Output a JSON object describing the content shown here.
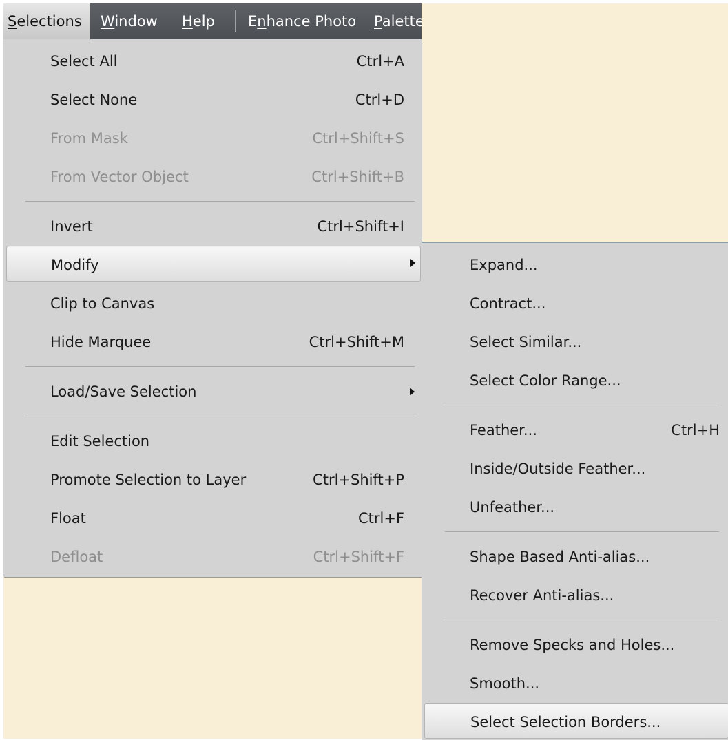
{
  "menubar": {
    "items": [
      {
        "label": "Selections",
        "mnemonic_index": 0
      },
      {
        "label": "Window",
        "mnemonic_index": 0
      },
      {
        "label": "Help",
        "mnemonic_index": 0
      },
      {
        "label": "Enhance Photo",
        "mnemonic_index": 1
      },
      {
        "label": "Palettes",
        "mnemonic_index": 0
      }
    ]
  },
  "selections_menu": {
    "items": [
      {
        "label": "Select All",
        "shortcut": "Ctrl+A",
        "disabled": false
      },
      {
        "label": "Select None",
        "shortcut": "Ctrl+D",
        "disabled": false
      },
      {
        "label": "From Mask",
        "shortcut": "Ctrl+Shift+S",
        "disabled": true
      },
      {
        "label": "From Vector Object",
        "shortcut": "Ctrl+Shift+B",
        "disabled": true
      },
      {
        "label": "Invert",
        "shortcut": "Ctrl+Shift+I",
        "disabled": false
      },
      {
        "label": "Modify",
        "shortcut": "",
        "disabled": false,
        "submenu": true,
        "highlighted": true
      },
      {
        "label": "Clip to Canvas",
        "shortcut": "",
        "disabled": false
      },
      {
        "label": "Hide Marquee",
        "shortcut": "Ctrl+Shift+M",
        "disabled": false
      },
      {
        "label": "Load/Save Selection",
        "shortcut": "",
        "disabled": false,
        "submenu": true
      },
      {
        "label": "Edit Selection",
        "shortcut": "",
        "disabled": false
      },
      {
        "label": "Promote Selection to Layer",
        "shortcut": "Ctrl+Shift+P",
        "disabled": false
      },
      {
        "label": "Float",
        "shortcut": "Ctrl+F",
        "disabled": false
      },
      {
        "label": "Defloat",
        "shortcut": "Ctrl+Shift+F",
        "disabled": true
      }
    ]
  },
  "modify_submenu": {
    "items": [
      {
        "label": "Expand...",
        "shortcut": ""
      },
      {
        "label": "Contract...",
        "shortcut": ""
      },
      {
        "label": "Select Similar...",
        "shortcut": ""
      },
      {
        "label": "Select Color Range...",
        "shortcut": ""
      },
      {
        "label": "Feather...",
        "shortcut": "Ctrl+H"
      },
      {
        "label": "Inside/Outside Feather...",
        "shortcut": ""
      },
      {
        "label": "Unfeather...",
        "shortcut": ""
      },
      {
        "label": "Shape Based Anti-alias...",
        "shortcut": ""
      },
      {
        "label": "Recover Anti-alias...",
        "shortcut": ""
      },
      {
        "label": "Remove Specks and Holes...",
        "shortcut": ""
      },
      {
        "label": "Smooth...",
        "shortcut": ""
      },
      {
        "label": "Select Selection Borders...",
        "shortcut": "",
        "highlighted": true
      }
    ]
  },
  "colors": {
    "workspace_background": "#f8efd6",
    "menubar_background": "#52575c",
    "menu_background": "#d3d3d3",
    "disabled_text": "#8f8f8f"
  }
}
